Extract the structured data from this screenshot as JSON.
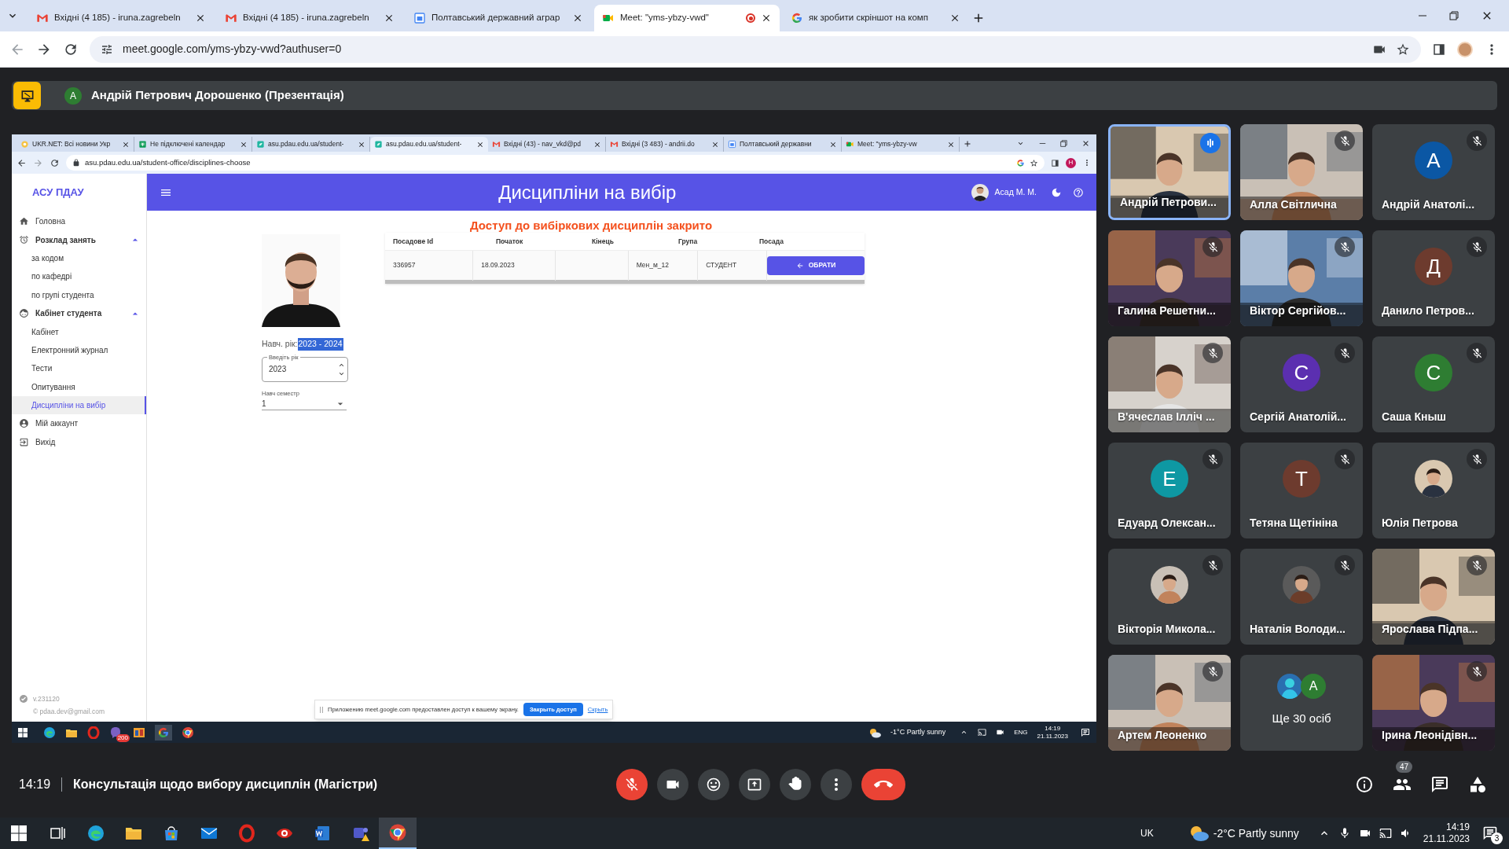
{
  "browser": {
    "tabs": [
      {
        "title": "Вхідні (4 185) - iruna.zagrebeln",
        "selected": false,
        "recording": false
      },
      {
        "title": "Вхідні (4 185) - iruna.zagrebeln",
        "selected": false,
        "recording": false
      },
      {
        "title": "Полтавський державний аграр",
        "selected": false,
        "recording": false
      },
      {
        "title": "Meet: \"yms-ybzy-vwd\"",
        "selected": true,
        "recording": true
      },
      {
        "title": "як зробити скріншот на комп",
        "selected": false,
        "recording": false
      }
    ],
    "url": "meet.google.com/yms-ybzy-vwd?authuser=0"
  },
  "presenter_bar": {
    "avatar_letter": "А",
    "title": "Андрій Петрович Дорошенко (Презентація)"
  },
  "shared_screen": {
    "tabs": [
      {
        "title": "UKR.NET: Всі новини Укр",
        "selected": false
      },
      {
        "title": "Не підключені календар",
        "selected": false
      },
      {
        "title": "asu.pdau.edu.ua/student-",
        "selected": false
      },
      {
        "title": "asu.pdau.edu.ua/student-",
        "selected": true
      },
      {
        "title": "Вхідні (43) - nav_vkd@pd",
        "selected": false
      },
      {
        "title": "Вхідні (3 483) - andrii.do",
        "selected": false
      },
      {
        "title": "Полтавський державни",
        "selected": false
      },
      {
        "title": "Meet: \"yms-ybzy-vw",
        "selected": false
      }
    ],
    "url": "asu.pdau.edu.ua/student-office/disciplines-choose",
    "profile_letter": "Н",
    "sidebar": {
      "brand": "АСУ ПДАУ",
      "items": [
        {
          "label": "Головна",
          "selected": false
        },
        {
          "label": "Розклад занять",
          "selected": false,
          "expanded": true,
          "children": [
            {
              "label": "за кодом",
              "selected": false
            },
            {
              "label": "по кафедрі",
              "selected": false
            },
            {
              "label": "по групі студента",
              "selected": false
            }
          ]
        },
        {
          "label": "Кабінет студента",
          "selected": false,
          "expanded": true,
          "children": [
            {
              "label": "Кабінет",
              "selected": false
            },
            {
              "label": "Електронний журнал",
              "selected": false
            },
            {
              "label": "Тести",
              "selected": false
            },
            {
              "label": "Опитування",
              "selected": false
            },
            {
              "label": "Дисципліни на вибір",
              "selected": true
            }
          ]
        },
        {
          "label": "Мій аккаунт",
          "selected": false
        },
        {
          "label": "Вихід",
          "selected": false
        }
      ],
      "version": "v.231120",
      "contact": "© pdaa.dev@gmail.com"
    },
    "header": {
      "title": "Дисципліни на вибір",
      "user": "Асад М. М."
    },
    "notice": "Доступ до вибіркових дисциплін закрито",
    "study_year": {
      "label": "Навч. рік:",
      "value": "2023 - 2024"
    },
    "year_field": {
      "label": "Введіть рік",
      "value": "2023"
    },
    "semester_field": {
      "label": "Навч семестр",
      "value": "1"
    },
    "table": {
      "columns": [
        "Посадове Id",
        "Початок",
        "Кінець",
        "Група",
        "Посада"
      ],
      "rows": [
        {
          "cells": [
            "336957",
            "18.09.2023",
            null,
            "Мен_м_12",
            "СТУДЕНТ"
          ],
          "action": "ОБРАТИ"
        }
      ]
    },
    "share_banner": {
      "message": "Приложению meet.google.com предоставлен доступ к вашему экрану.",
      "button": "Закрыть доступ",
      "link": "Скрыть"
    },
    "taskbar": {
      "viber_badge": "200",
      "weather": "-1°C Partly sunny",
      "language": "ENG",
      "time": "14:19",
      "date": "21.11.2023"
    }
  },
  "participants": [
    {
      "name": "Андрій Петрови...",
      "kind": "video",
      "muted": false,
      "speaking": true
    },
    {
      "name": "Алла Світлична",
      "kind": "video",
      "muted": true,
      "speaking": false
    },
    {
      "name": "Андрій Анатолі...",
      "kind": "avatar",
      "letter": "A",
      "color": "#0b57a4",
      "muted": true,
      "speaking": false
    },
    {
      "name": "Галина Решетни...",
      "kind": "video",
      "muted": true,
      "speaking": false
    },
    {
      "name": "Віктор Сергійов...",
      "kind": "video",
      "muted": true,
      "speaking": false
    },
    {
      "name": "Данило Петров...",
      "kind": "avatar",
      "letter": "Д",
      "color": "#6d3b2e",
      "muted": true,
      "speaking": false
    },
    {
      "name": "В'ячеслав Ілліч ...",
      "kind": "video",
      "muted": true,
      "speaking": false
    },
    {
      "name": "Сергій Анатолій...",
      "kind": "avatar",
      "letter": "С",
      "color": "#5b2fb0",
      "muted": true,
      "speaking": false
    },
    {
      "name": "Саша Кныш",
      "kind": "avatar",
      "letter": "С",
      "color": "#2e7d32",
      "muted": true,
      "speaking": false
    },
    {
      "name": "Едуард Олексан...",
      "kind": "avatar",
      "letter": "E",
      "color": "#0e98a3",
      "muted": true,
      "speaking": false
    },
    {
      "name": "Тетяна Щетініна",
      "kind": "avatar",
      "letter": "Т",
      "color": "#6d3b2e",
      "muted": true,
      "speaking": false
    },
    {
      "name": "Юлія Петрова",
      "muted": true,
      "speaking": false
    },
    {
      "name": "Вікторія Микола...",
      "muted": true,
      "speaking": false
    },
    {
      "name": "Наталія Володи...",
      "muted": true,
      "speaking": false
    },
    {
      "name": "Ярослава Підпа...",
      "kind": "video",
      "muted": true,
      "speaking": false
    },
    {
      "name": "Артем Леоненко",
      "kind": "video",
      "muted": true,
      "speaking": false
    },
    {
      "name": "Ще 30 осіб",
      "kind": "more",
      "letter": "A",
      "color": "#2e7d32"
    },
    {
      "name": "Ірина Леонідівн...",
      "kind": "video",
      "muted": true,
      "speaking": false
    }
  ],
  "meeting": {
    "time": "14:19",
    "title": "Консультація щодо вибору дисциплін (Магістри)",
    "mic_on": false,
    "participant_count": "47"
  },
  "taskbar": {
    "language": "UK",
    "weather": "-2°C Partly sunny",
    "time": "14:19",
    "date": "21.11.2023",
    "notifications": "3"
  }
}
